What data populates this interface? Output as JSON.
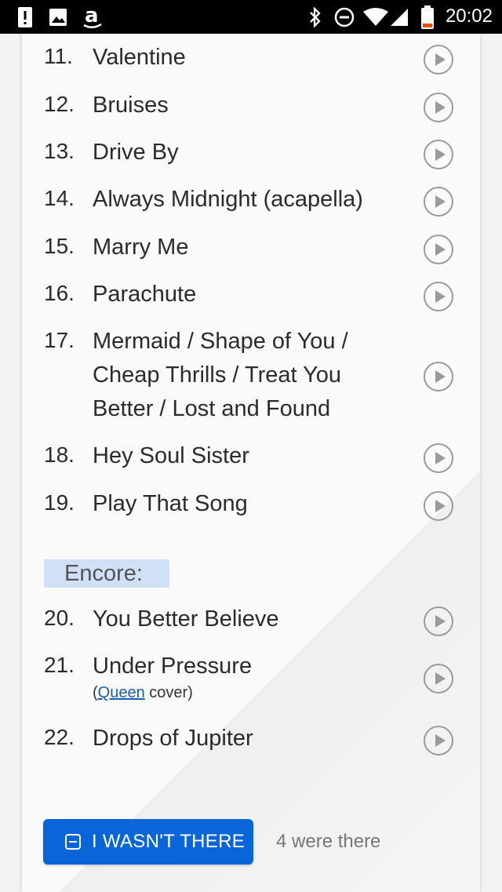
{
  "status_bar": {
    "time": "20:02",
    "icons": [
      "alert-icon",
      "image-icon",
      "amazon-icon",
      "bluetooth-icon",
      "do-not-disturb-icon",
      "wifi-icon",
      "signal-icon",
      "battery-low-icon"
    ],
    "battery_color": "#e65100"
  },
  "setlist": {
    "songs": [
      {
        "number": "11.",
        "title": "Valentine"
      },
      {
        "number": "12.",
        "title": "Bruises"
      },
      {
        "number": "13.",
        "title": "Drive By"
      },
      {
        "number": "14.",
        "title": "Always Midnight (acapella)"
      },
      {
        "number": "15.",
        "title": "Marry Me"
      },
      {
        "number": "16.",
        "title": "Parachute"
      },
      {
        "number": "17.",
        "title": "Mermaid / Shape of You / Cheap Thrills / Treat You Better / Lost and Found"
      },
      {
        "number": "18.",
        "title": "Hey Soul Sister"
      },
      {
        "number": "19.",
        "title": "Play That Song"
      }
    ],
    "encore_label": "Encore:",
    "encore_songs": [
      {
        "number": "20.",
        "title": "You Better Believe"
      },
      {
        "number": "21.",
        "title": "Under Pressure",
        "note_prefix": "(",
        "note_link": "Queen",
        "note_suffix": " cover)"
      },
      {
        "number": "22.",
        "title": "Drops of Jupiter"
      }
    ]
  },
  "attendance": {
    "button_label": "I WASN'T THERE",
    "count_text": "4 were there",
    "button_color": "#0a66d8"
  },
  "colors": {
    "encore_highlight": "#cfe0f7",
    "link": "#1a5fb4"
  }
}
